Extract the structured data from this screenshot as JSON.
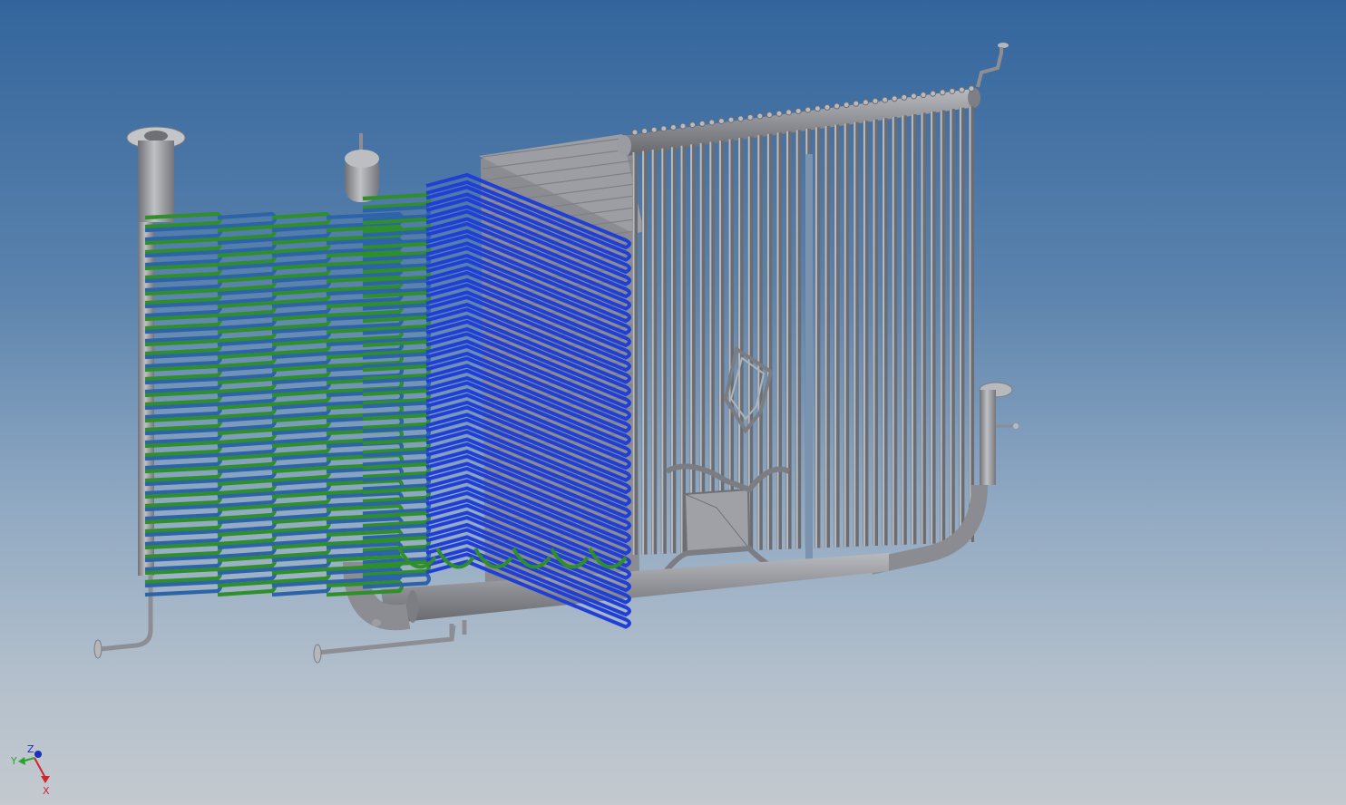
{
  "app": {
    "title": "",
    "background_top": "#33659c",
    "background_bottom": "#c4c9cf"
  },
  "model": {
    "metal_color": "#8d8f94",
    "metal_highlight": "#b9bbbf",
    "metal_shadow": "#6b6d72",
    "coil_blue_color": "#1f3fd6",
    "coil_green_color": "#2f8f2a",
    "coil_steelblue_color": "#2d63a8",
    "upper_tube_count": 36,
    "wall_tube_count": 34,
    "coil_row_count": 30
  },
  "triad": {
    "x_label": "X",
    "y_label": "Y",
    "z_label": "Z",
    "x_color": "#d0262b",
    "y_color": "#2aa52c",
    "z_color": "#1d2fb8"
  }
}
